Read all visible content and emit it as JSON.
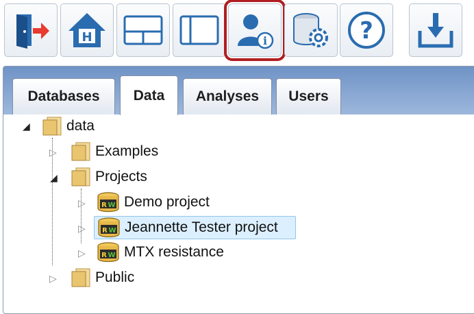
{
  "toolbar": {
    "buttons": [
      {
        "icon": "logout-icon",
        "active": false
      },
      {
        "icon": "home-icon",
        "active": false
      },
      {
        "icon": "split-horizontal-view-icon",
        "active": false
      },
      {
        "icon": "split-vertical-view-icon",
        "active": false
      },
      {
        "icon": "user-info-icon",
        "active": true
      },
      {
        "icon": "database-settings-icon",
        "active": false
      },
      {
        "icon": "help-icon",
        "active": false
      },
      {
        "icon": "download-icon",
        "active": false
      }
    ],
    "highlight_color": "#b01e22"
  },
  "tabs": [
    {
      "label": "Databases",
      "selected": false
    },
    {
      "label": "Data",
      "selected": true
    },
    {
      "label": "Analyses",
      "selected": false
    },
    {
      "label": "Users",
      "selected": false
    }
  ],
  "tree": {
    "root": {
      "label": "data",
      "expanded": true,
      "icon": "folder-icon"
    },
    "examples": {
      "label": "Examples",
      "expanded": false,
      "icon": "folder-icon"
    },
    "projects": {
      "label": "Projects",
      "expanded": true,
      "icon": "folder-icon"
    },
    "demo": {
      "label": "Demo project",
      "expanded": false,
      "icon": "project-database-icon"
    },
    "jeannette": {
      "label": "Jeannette Tester project",
      "expanded": false,
      "selected": true,
      "icon": "project-database-icon"
    },
    "mtx": {
      "label": "MTX resistance",
      "expanded": false,
      "icon": "project-database-icon"
    },
    "public": {
      "label": "Public",
      "expanded": false,
      "icon": "folder-icon"
    }
  },
  "colors": {
    "tab_strip": "#7d9fcf",
    "selection": "#dcefff",
    "icon_blue": "#2a6cb0"
  }
}
